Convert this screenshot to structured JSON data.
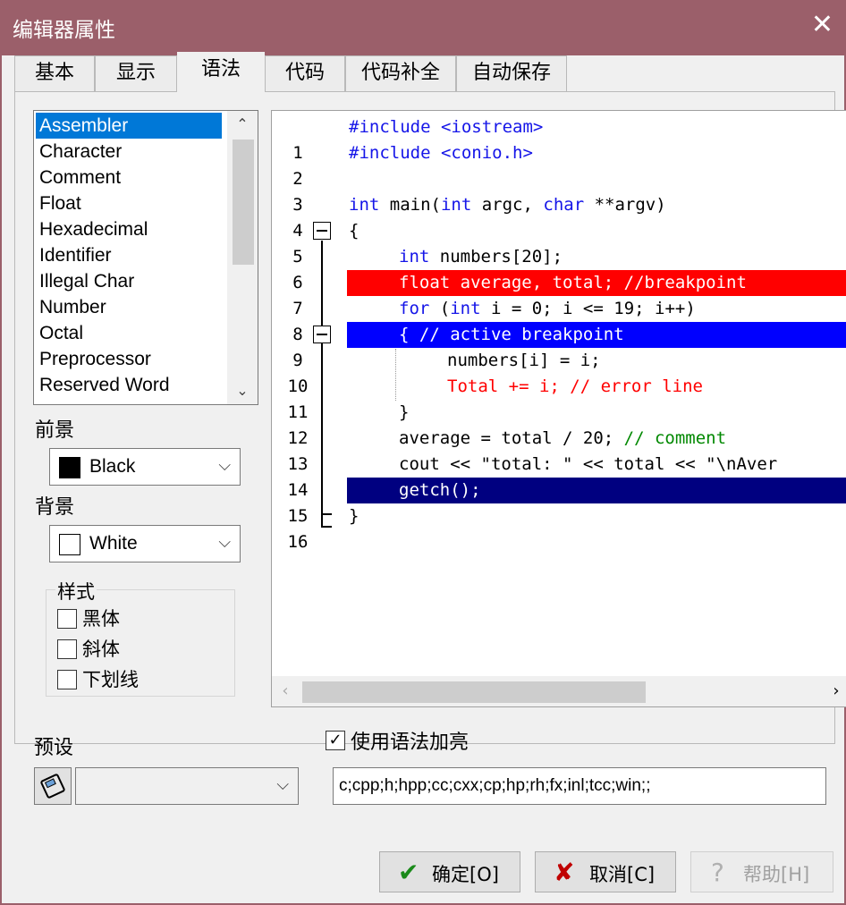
{
  "window": {
    "title": "编辑器属性",
    "close_glyph": "✕"
  },
  "tabs": [
    {
      "label": "基本"
    },
    {
      "label": "显示"
    },
    {
      "label": "语法"
    },
    {
      "label": "代码"
    },
    {
      "label": "代码补全"
    },
    {
      "label": "自动保存"
    }
  ],
  "syntax_list": {
    "items": [
      "Assembler",
      "Character",
      "Comment",
      "Float",
      "Hexadecimal",
      "Identifier",
      "Illegal Char",
      "Number",
      "Octal",
      "Preprocessor",
      "Reserved Word"
    ],
    "selected": "Assembler",
    "up_arrow": "⌃",
    "down_arrow": "⌄"
  },
  "foreground": {
    "label": "前景",
    "value": "Black",
    "swatch_color": "#000000",
    "chevron": "⌵"
  },
  "background": {
    "label": "背景",
    "value": "White",
    "swatch_color": "#ffffff",
    "chevron": "⌵"
  },
  "style_group": {
    "legend": "样式",
    "bold": "黑体",
    "italic": "斜体",
    "underline": "下划线"
  },
  "preview": {
    "line_numbers": [
      "1",
      "2",
      "3",
      "4",
      "5",
      "6",
      "7",
      "8",
      "9",
      "10",
      "11",
      "12",
      "13",
      "14",
      "15",
      "16"
    ],
    "lines": {
      "l1": "#include <iostream>",
      "l2": "#include <conio.h>",
      "l4_kw1": "int",
      "l4_mid": " main(",
      "l4_kw2": "int",
      "l4_mid2": " argc, ",
      "l4_kw3": "char",
      "l4_end": " **argv)",
      "l5": "{",
      "l6_kw": "int",
      "l6_rest": " numbers[20];",
      "l7": "float average, total; //breakpoint",
      "l8_kw1": "for",
      "l8_mid": " (",
      "l8_kw2": "int",
      "l8_rest": " i = 0; i <= 19; i++)",
      "l9": "{ // active breakpoint",
      "l10": "numbers[i] = i;",
      "l11": "Total += i; // error line",
      "l12": "}",
      "l13_code": "average = total / 20; ",
      "l13_comment": "// comment",
      "l14": "cout << \"total: \" << total << \"\\nAver",
      "l15": "getch();",
      "l16": "}"
    },
    "colors": {
      "breakpoint_bg": "#ff0000",
      "active_breakpoint_bg": "#0000ff",
      "current_line_bg": "#000080",
      "error_fg": "#ff0000"
    },
    "scroll_left": "‹",
    "scroll_right": "›"
  },
  "use_highlight": {
    "label": "使用语法加亮",
    "checked": true,
    "check_glyph": "✓"
  },
  "preset": {
    "label": "预设",
    "value": "",
    "chevron": "⌵"
  },
  "extensions": {
    "value": "c;cpp;h;hpp;cc;cxx;cp;hp;rh;fx;inl;tcc;win;;"
  },
  "buttons": {
    "ok": {
      "label": "确定[O]",
      "icon": "✔"
    },
    "cancel": {
      "label": "取消[C]",
      "icon": "✘"
    },
    "help": {
      "label": "帮助[H]",
      "icon": "?"
    }
  }
}
